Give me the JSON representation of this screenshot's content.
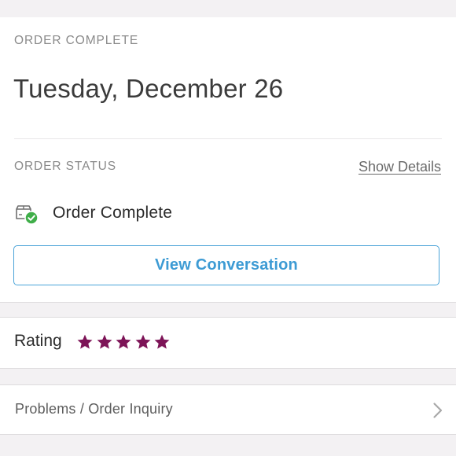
{
  "order": {
    "section_label": "ORDER COMPLETE",
    "date_title": "Tuesday, December 26"
  },
  "status": {
    "section_label": "ORDER STATUS",
    "show_details_label": "Show Details",
    "status_text": "Order Complete",
    "icon": "package-check-icon",
    "check_color": "#3fae49"
  },
  "conversation": {
    "button_label": "View Conversation",
    "accent_color": "#3d9bd4"
  },
  "rating": {
    "label": "Rating",
    "stars": 5,
    "max_stars": 5,
    "star_color": "#7d1457"
  },
  "problems": {
    "label": "Problems / Order Inquiry",
    "icon": "chevron-right-icon"
  }
}
